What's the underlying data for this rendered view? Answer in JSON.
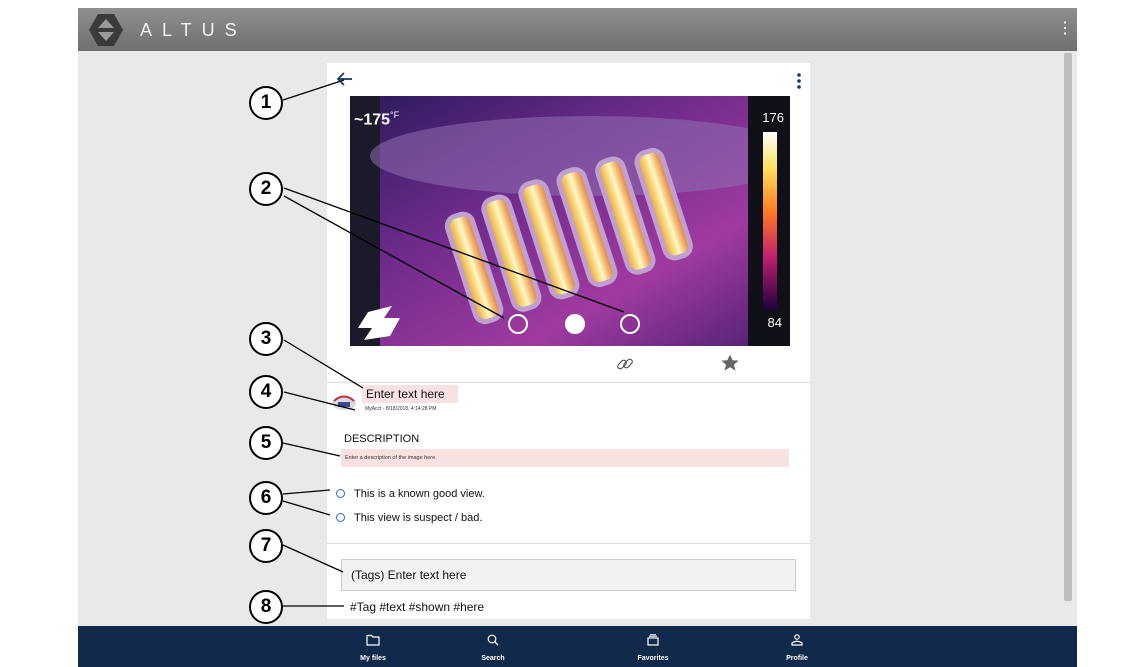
{
  "app": {
    "brand": "ALTUS"
  },
  "image_card": {
    "temperature_readout": "~175",
    "temperature_unit": "°F",
    "scale_max": "176",
    "scale_min": "84",
    "title_placeholder": "Enter text here",
    "meta": "MyAcct - 8/18/2018, 4:14:28 PM",
    "description_heading": "DESCRIPTION",
    "description_placeholder": "Enter a description of the image here.",
    "options": [
      "This is a known good view.",
      "This view is suspect / bad."
    ],
    "tags_placeholder": "(Tags) Enter text here",
    "tags": "#Tag  #text  #shown #here"
  },
  "bottom_nav": [
    {
      "label": "My files",
      "icon": "folder-icon"
    },
    {
      "label": "Search",
      "icon": "search-icon"
    },
    {
      "label": "Favorites",
      "icon": "favorites-icon"
    },
    {
      "label": "Profile",
      "icon": "profile-icon"
    }
  ],
  "callouts": [
    "1",
    "2",
    "3",
    "4",
    "5",
    "6",
    "7",
    "8"
  ],
  "colors": {
    "topbar": "#7a7a7a",
    "bottombar": "#11294a",
    "field_highlight": "#f8e1e1",
    "radio": "#2e6db4"
  }
}
